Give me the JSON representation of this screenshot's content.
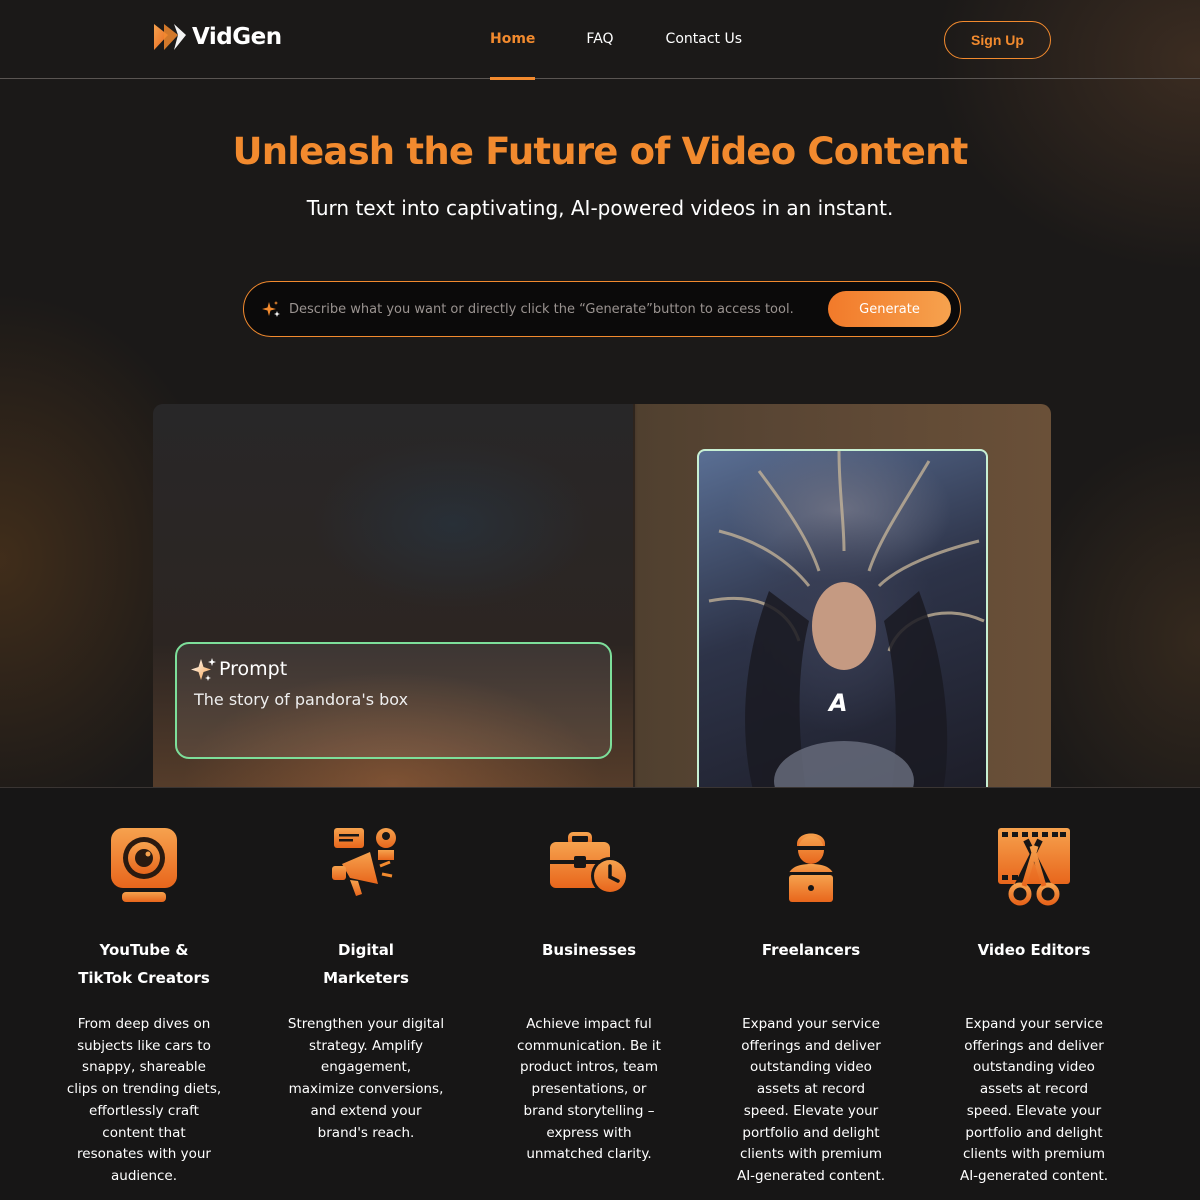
{
  "brand": {
    "name": "VidGen",
    "accent": "#f28a2e"
  },
  "nav": {
    "items": [
      {
        "label": "Home",
        "active": true
      },
      {
        "label": "FAQ",
        "active": false
      },
      {
        "label": "Contact Us",
        "active": false
      }
    ],
    "signup_label": "Sign Up"
  },
  "hero": {
    "headline": "Unleash the Future of Video Content",
    "subhead": "Turn text into captivating, AI-powered videos in an instant.",
    "search_placeholder": "Describe what you want or directly click the “Generate”button to access tool.",
    "generate_label": "Generate"
  },
  "demo": {
    "prompt_title": "Prompt",
    "prompt_text": "The story of pandora's box",
    "video_caption": "A"
  },
  "features": [
    {
      "icon": "webcam-icon",
      "title_lines": [
        "YouTube &",
        "TikTok Creators"
      ],
      "description_lines": [
        "From deep dives on",
        "subjects like cars to",
        "snappy, shareable",
        "clips on trending diets,",
        "effortlessly craft",
        "content that",
        "resonates with your",
        "audience."
      ]
    },
    {
      "icon": "megaphone-icon",
      "title_lines": [
        "Digital",
        "Marketers"
      ],
      "description_lines": [
        "Strengthen your digital",
        "strategy. Amplify",
        "engagement,",
        "maximize conversions,",
        "and extend your",
        "brand's reach."
      ]
    },
    {
      "icon": "briefcase-clock-icon",
      "title_lines": [
        "Businesses"
      ],
      "description_lines": [
        "Achieve impact ful",
        "communication. Be it",
        "product intros, team",
        "presentations, or",
        "brand storytelling –",
        "express with",
        "unmatched clarity."
      ]
    },
    {
      "icon": "laptop-user-icon",
      "title_lines": [
        "Freelancers"
      ],
      "description_lines": [
        "Expand your service",
        "offerings and deliver",
        "outstanding video",
        "assets at record",
        "speed. Elevate your",
        "portfolio and delight",
        "clients with premium",
        "AI-generated content."
      ]
    },
    {
      "icon": "film-scissors-icon",
      "title_lines": [
        "Video Editors"
      ],
      "description_lines": [
        "Expand your service",
        "offerings and deliver",
        "outstanding video",
        "assets at record",
        "speed. Elevate your",
        "portfolio and delight",
        "clients with premium",
        "AI-generated content."
      ]
    }
  ]
}
